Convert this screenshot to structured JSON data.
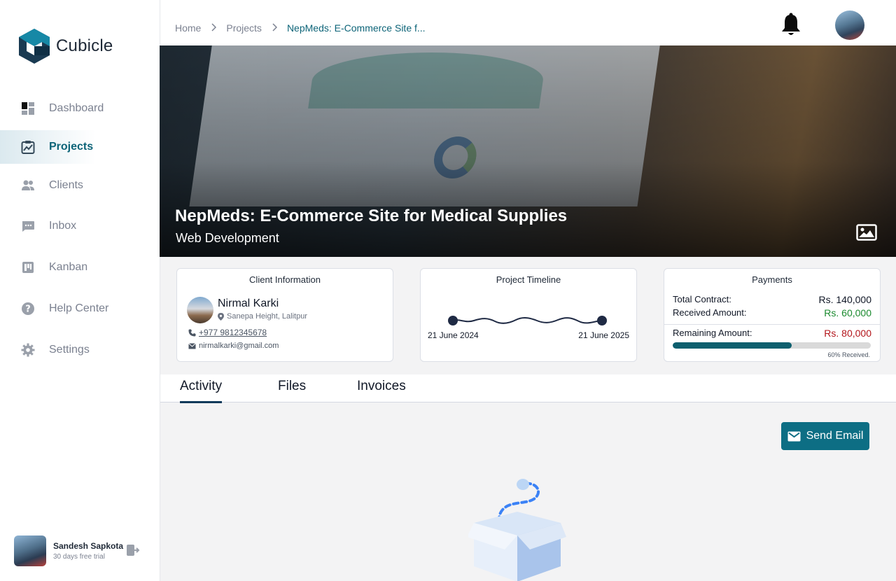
{
  "app": {
    "name": "Cubicle"
  },
  "sidebar": {
    "items": [
      {
        "label": "Dashboard",
        "icon": "dashboard-icon"
      },
      {
        "label": "Projects",
        "icon": "chart-clipboard-icon",
        "active": true
      },
      {
        "label": "Clients",
        "icon": "users-icon"
      },
      {
        "label": "Inbox",
        "icon": "chat-icon"
      },
      {
        "label": "Kanban",
        "icon": "kanban-icon"
      },
      {
        "label": "Help Center",
        "icon": "help-icon"
      },
      {
        "label": "Settings",
        "icon": "gear-icon"
      }
    ],
    "user": {
      "name": "Sandesh Sapkota",
      "plan": "30 days free trial"
    }
  },
  "breadcrumb": {
    "home": "Home",
    "projects": "Projects",
    "current": "NepMeds: E-Commerce Site f..."
  },
  "project": {
    "title": "NepMeds: E-Commerce Site for Medical Supplies",
    "category": "Web Development"
  },
  "client_card": {
    "title": "Client Information",
    "name": "Nirmal Karki",
    "location": "Sanepa Height, Lalitpur",
    "phone": "+977 9812345678",
    "email": "nirmalkarki@gmail.com"
  },
  "timeline_card": {
    "title": "Project Timeline",
    "start": "21 June 2024",
    "end": "21 June 2025"
  },
  "payments_card": {
    "title": "Payments",
    "total_label": "Total Contract:",
    "total_value": "Rs. 140,000",
    "received_label": "Received Amount:",
    "received_value": "Rs. 60,000",
    "remaining_label": "Remaining Amount:",
    "remaining_value": "Rs. 80,000",
    "received_fraction": 0.6,
    "progress_note": "60% Received."
  },
  "tabs": [
    {
      "label": "Activity",
      "active": true
    },
    {
      "label": "Files"
    },
    {
      "label": "Invoices"
    }
  ],
  "actions": {
    "send_email": "Send Email"
  },
  "colors": {
    "accent": "#0d6e84",
    "positive": "#1a8a2e",
    "negative": "#b3151b"
  }
}
